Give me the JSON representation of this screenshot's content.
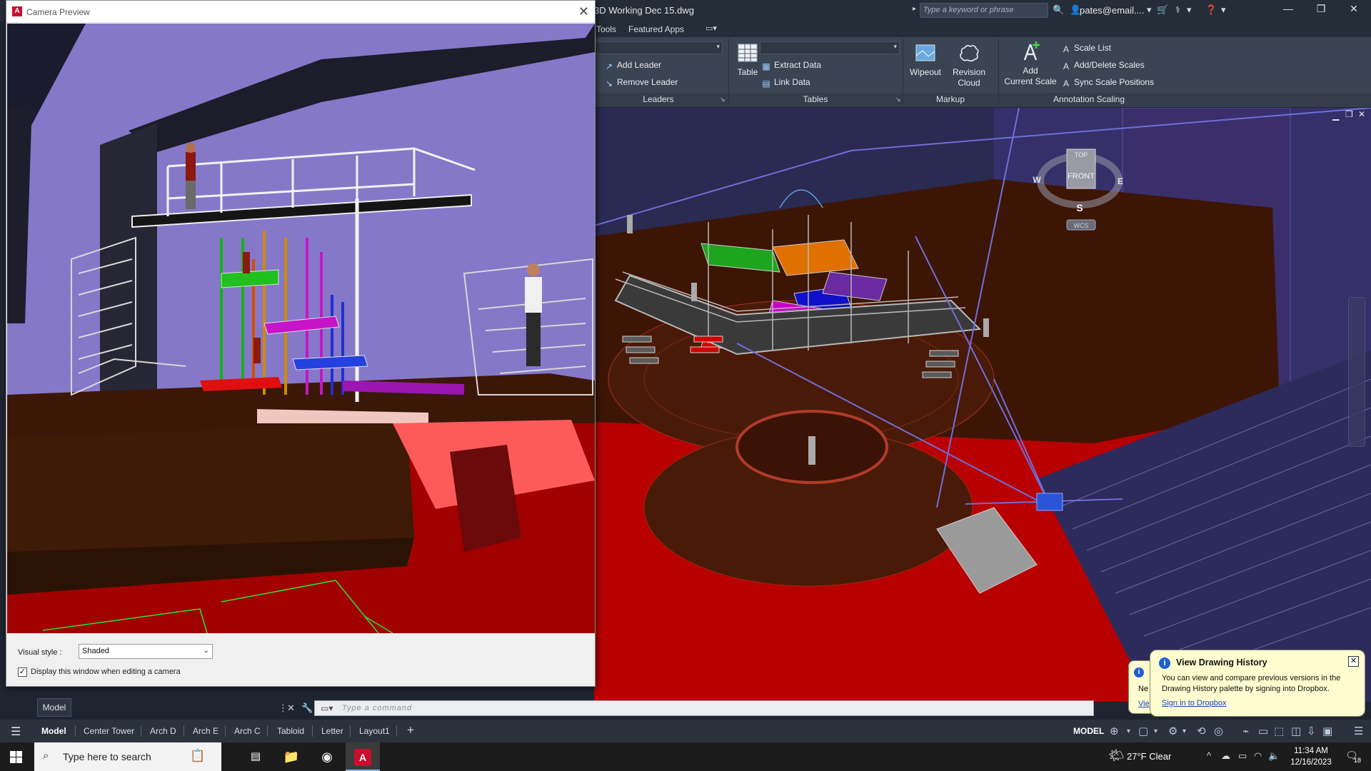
{
  "app": {
    "document_title": "3D Working Dec 15.dwg",
    "search_placeholder": "Type a keyword or phrase",
    "user": "pates@email....",
    "accent": "#c8102e"
  },
  "ribbon_tabs": [
    "Tools",
    "Featured Apps"
  ],
  "ribbon": {
    "leaders": {
      "add_leader": "Add Leader",
      "remove_leader": "Remove Leader",
      "panel_label": "Leaders"
    },
    "tables": {
      "table": "Table",
      "extract_data": "Extract Data",
      "link_data": "Link Data",
      "panel_label": "Tables"
    },
    "markup": {
      "wipeout": "Wipeout",
      "revision_cloud_1": "Revision",
      "revision_cloud_2": "Cloud",
      "panel_label": "Markup"
    },
    "annotation_scaling": {
      "add_scale_1": "Add",
      "add_scale_2": "Current Scale",
      "scale_list": "Scale List",
      "add_delete_scales": "Add/Delete Scales",
      "sync_scale_positions": "Sync Scale Positions",
      "panel_label": "Annotation Scaling"
    }
  },
  "viewcube": {
    "top": "TOP",
    "front": "FRONT",
    "north_west": "W",
    "east": "E",
    "south": "S",
    "wcs": "WCS"
  },
  "camera_preview": {
    "title": "Camera Preview",
    "visual_style_label": "Visual style :",
    "visual_style_value": "Shaded",
    "display_checkbox_label": "Display this window when editing a camera",
    "display_checkbox_checked": true
  },
  "command_line": {
    "placeholder": "Type  a  command",
    "model_tooltip": "Model"
  },
  "layout_tabs": [
    "Model",
    "Center Tower",
    "Arch D",
    "Arch E",
    "Arch C",
    "Tabloid",
    "Letter",
    "Layout1"
  ],
  "status": {
    "model": "MODEL"
  },
  "notification": {
    "title": "View Drawing History",
    "body": "You can view and compare previous versions in the Drawing History palette by signing into Dropbox.",
    "link": "Sign in to Dropbox",
    "back_text": "Ne",
    "back_link": "Vie"
  },
  "taskbar": {
    "search_placeholder": "Type here to search",
    "weather": "27°F  Clear",
    "time": "11:34 AM",
    "date": "12/16/2023",
    "notification_count": "18"
  }
}
